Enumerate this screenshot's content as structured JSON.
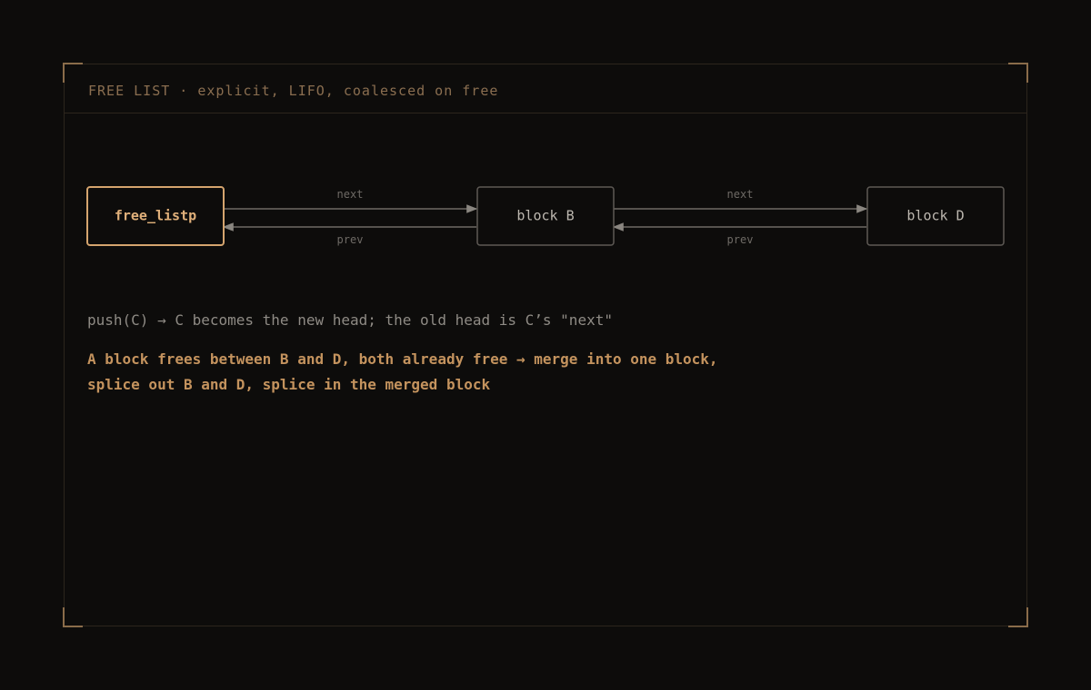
{
  "panel": {
    "title": "FREE LIST · explicit, LIFO, coalesced on free"
  },
  "diagram": {
    "nodes": [
      {
        "id": "head",
        "label": "free_listp",
        "emphasis": true
      },
      {
        "id": "b",
        "label": "block B",
        "emphasis": false
      },
      {
        "id": "d",
        "label": "block D",
        "emphasis": false
      }
    ],
    "edges": [
      {
        "from": "head",
        "to": "b",
        "next_label": "next",
        "prev_label": "prev"
      },
      {
        "from": "b",
        "to": "d",
        "next_label": "next",
        "prev_label": "prev"
      }
    ]
  },
  "notes": {
    "push": "push(C) → C becomes the new head; the old head is C’s \"next\"",
    "coalesce_line1": "A block frees between B and D, both already free → merge into one block,",
    "coalesce_line2": "splice out B and D, splice in the merged block"
  },
  "colors": {
    "accent": "#d4a46e",
    "background": "#0d0c0b"
  }
}
